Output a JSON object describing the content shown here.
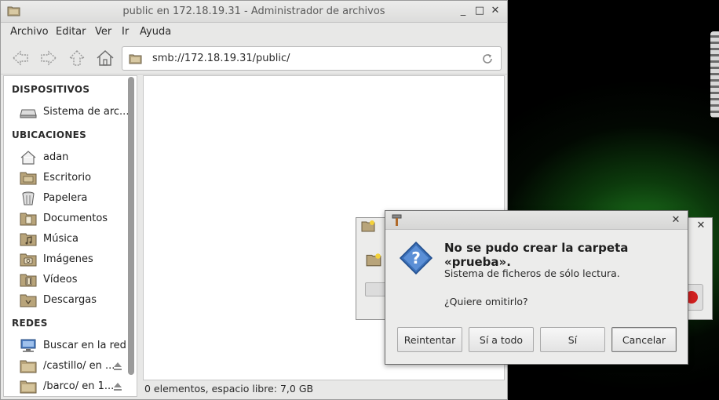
{
  "window": {
    "title": "public en 172.18.19.31 - Administrador de archivos",
    "controls": {
      "minimize": "_",
      "maximize": "□",
      "close": "✕"
    }
  },
  "menu": [
    "Archivo",
    "Editar",
    "Ver",
    "Ir",
    "Ayuda"
  ],
  "toolbar": {
    "location": "smb://172.18.19.31/public/"
  },
  "sidebar": {
    "sections": {
      "devices": "DISPOSITIVOS",
      "places": "UBICACIONES",
      "network": "REDES"
    },
    "devices": [
      {
        "label": "Sistema de arc...",
        "icon": "drive-icon"
      }
    ],
    "places": [
      {
        "label": "adan",
        "icon": "home-icon"
      },
      {
        "label": "Escritorio",
        "icon": "folder-desktop-icon"
      },
      {
        "label": "Papelera",
        "icon": "trash-icon"
      },
      {
        "label": "Documentos",
        "icon": "folder-documents-icon"
      },
      {
        "label": "Música",
        "icon": "folder-music-icon"
      },
      {
        "label": "Imágenes",
        "icon": "folder-pictures-icon"
      },
      {
        "label": "Vídeos",
        "icon": "folder-videos-icon"
      },
      {
        "label": "Descargas",
        "icon": "folder-downloads-icon"
      }
    ],
    "network": [
      {
        "label": "Buscar en la red",
        "icon": "network-icon"
      },
      {
        "label": "/castillo/ en ...",
        "icon": "folder-remote-icon"
      },
      {
        "label": "/barco/ en 1...",
        "icon": "folder-remote-icon"
      }
    ]
  },
  "status": "0 elementos, espacio libre: 7,0 GB",
  "dialog": {
    "heading": "No se pudo crear la carpeta «prueba».",
    "message": "Sistema de ficheros de sólo lectura.",
    "question": "¿Quiere omitirlo?",
    "buttons": {
      "retry": "Reintentar",
      "yes_all": "Sí a todo",
      "yes": "Sí",
      "cancel": "Cancelar"
    },
    "close": "✕"
  },
  "back_dialog": {
    "close": "✕"
  },
  "colors": {
    "dialog_icon": "#3b6fb6",
    "stop_button": "#d01f1f"
  }
}
